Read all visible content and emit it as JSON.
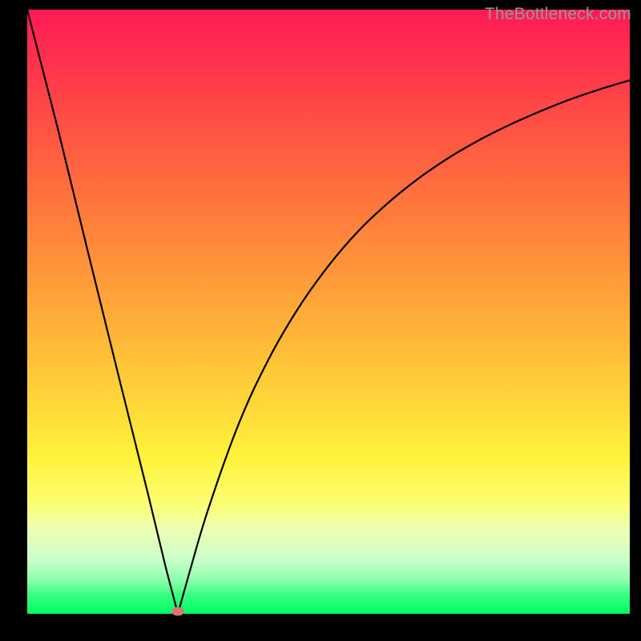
{
  "watermark": "TheBottleneck.com",
  "chart_data": {
    "type": "line",
    "title": "",
    "xlabel": "",
    "ylabel": "",
    "xlim": [
      0,
      100
    ],
    "ylim": [
      0,
      100
    ],
    "x": [
      0,
      5,
      10,
      15,
      20,
      23,
      25,
      27,
      30,
      35,
      40,
      45,
      50,
      55,
      60,
      65,
      70,
      75,
      80,
      85,
      90,
      95,
      100
    ],
    "values": [
      100,
      80.6,
      60.2,
      40.0,
      20.0,
      7.6,
      0.0,
      7.1,
      17.2,
      31.2,
      42.0,
      50.6,
      57.6,
      63.4,
      68.1,
      72.1,
      75.5,
      78.4,
      80.9,
      83.1,
      85.1,
      86.8,
      88.3
    ],
    "minimum_point": {
      "x": 25,
      "y": 0
    }
  }
}
